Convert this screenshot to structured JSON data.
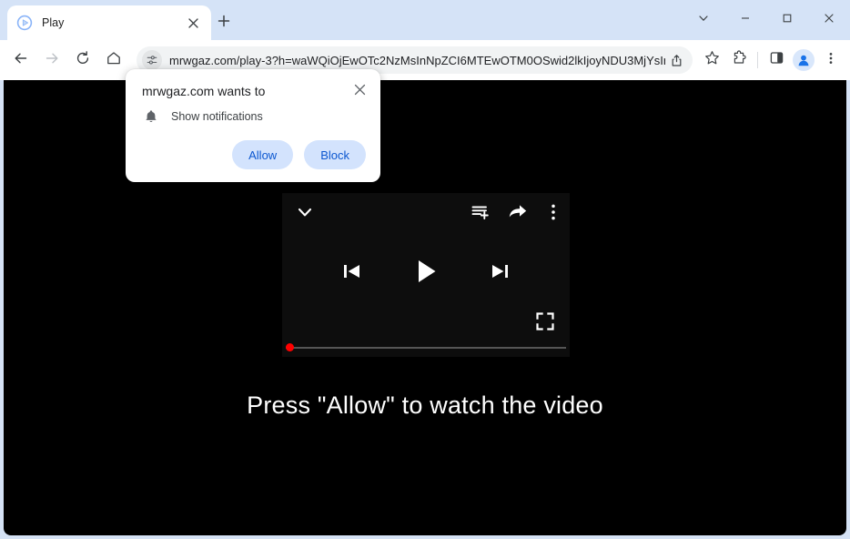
{
  "browser": {
    "tab": {
      "title": "Play",
      "favicon_icon": "play-favicon",
      "close_icon": "close-icon"
    },
    "new_tab_icon": "plus-icon",
    "window_controls": [
      {
        "name": "tab-search",
        "icon": "chevron-down-icon"
      },
      {
        "name": "minimize",
        "icon": "minimize-icon"
      },
      {
        "name": "maximize",
        "icon": "maximize-icon"
      },
      {
        "name": "close",
        "icon": "close-icon"
      }
    ],
    "nav": [
      {
        "name": "back",
        "icon": "arrow-left-icon"
      },
      {
        "name": "forward",
        "icon": "arrow-right-icon"
      },
      {
        "name": "reload",
        "icon": "reload-icon"
      },
      {
        "name": "home",
        "icon": "home-icon"
      }
    ],
    "omnibox": {
      "site_info_icon": "site-settings-icon",
      "url": "mrwgaz.com/play-3?h=waWQiOjEwOTc2NzMsInNpZCI6MTEwOTM0OSwid2lkIjoyNDU3MjYsInNyYyI6...",
      "share_icon": "share-icon"
    },
    "toolbar_icons": [
      {
        "name": "bookmark",
        "icon": "star-icon"
      },
      {
        "name": "extensions",
        "icon": "puzzle-icon"
      },
      {
        "name": "side-panel",
        "icon": "side-panel-icon"
      },
      {
        "name": "profile",
        "icon": "avatar-icon"
      },
      {
        "name": "chrome-menu",
        "icon": "three-dots-vertical-icon"
      }
    ]
  },
  "permission_dialog": {
    "title": "mrwgaz.com wants to",
    "permission_icon": "bell-icon",
    "permission_label": "Show notifications",
    "close_icon": "close-icon",
    "allow_label": "Allow",
    "block_label": "Block",
    "button_bg": "#d3e3fd",
    "button_text_color": "#0b57d0"
  },
  "page": {
    "background": "#000000",
    "cta_text": "Press \"Allow\" to watch the video",
    "player": {
      "background": "#0d0d0d",
      "collapse_icon": "chevron-down-icon",
      "queue_icon": "add-to-queue-icon",
      "share_icon": "share-arrow-icon",
      "more_icon": "three-dots-vertical-icon",
      "previous_icon": "skip-previous-icon",
      "play_icon": "play-icon",
      "next_icon": "skip-next-icon",
      "fullscreen_icon": "fullscreen-icon",
      "progress_percent": 0,
      "scrubber_color": "#ff0000",
      "track_color": "#555555"
    }
  }
}
